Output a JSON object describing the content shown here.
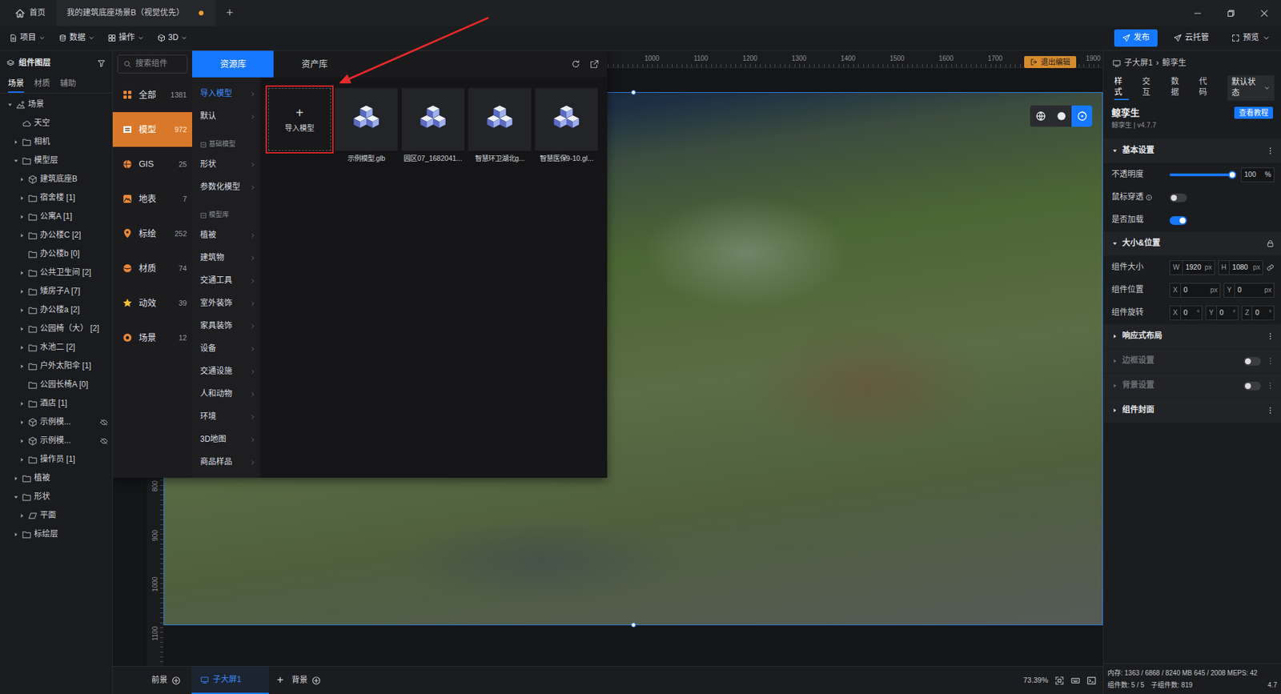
{
  "window": {
    "tabs": [
      {
        "label": "首页",
        "kind": "home",
        "selected": false,
        "unsaved": false
      },
      {
        "label": "我的建筑底座场景B（视觉优先）",
        "kind": "document",
        "selected": true,
        "unsaved": true
      }
    ],
    "add_tab": "+"
  },
  "toolbar": {
    "menus": [
      {
        "label": "项目",
        "kind": "file"
      },
      {
        "label": "数据",
        "kind": "database"
      },
      {
        "label": "操作",
        "kind": "grid"
      },
      {
        "label": "3D",
        "kind": "cube"
      }
    ],
    "actions": [
      {
        "label": "发布",
        "kind": "send",
        "primary": true,
        "dropdown": false
      },
      {
        "label": "云托管",
        "kind": "send",
        "primary": false,
        "dropdown": false
      },
      {
        "label": "预览",
        "kind": "fullscreen",
        "primary": false,
        "dropdown": true
      }
    ]
  },
  "layers": {
    "title": "组件图层",
    "tabs": [
      {
        "label": "场景",
        "selected": true
      },
      {
        "label": "材质",
        "selected": false
      },
      {
        "label": "辅助",
        "selected": false
      }
    ],
    "tree": [
      {
        "label": "场景",
        "level": 0,
        "kind": "scene",
        "expandable": true,
        "expanded": true,
        "hidden": false
      },
      {
        "label": "天空",
        "level": 1,
        "kind": "sky",
        "expandable": false,
        "expanded": false,
        "hidden": false
      },
      {
        "label": "相机",
        "level": 1,
        "kind": "folder",
        "expandable": true,
        "expanded": false,
        "hidden": false
      },
      {
        "label": "模型层",
        "level": 1,
        "kind": "folder",
        "expandable": true,
        "expanded": true,
        "hidden": false
      },
      {
        "label": "建筑底座B",
        "level": 2,
        "kind": "model",
        "expandable": true,
        "expanded": false,
        "hidden": false
      },
      {
        "label": "宿舍楼 [1]",
        "level": 2,
        "kind": "folder",
        "expandable": true,
        "expanded": false,
        "hidden": false
      },
      {
        "label": "公寓A [1]",
        "level": 2,
        "kind": "folder",
        "expandable": true,
        "expanded": false,
        "hidden": false
      },
      {
        "label": "办公楼C [2]",
        "level": 2,
        "kind": "folder",
        "expandable": true,
        "expanded": false,
        "hidden": false
      },
      {
        "label": "办公楼b [0]",
        "level": 2,
        "kind": "folder",
        "expandable": false,
        "expanded": false,
        "hidden": false
      },
      {
        "label": "公共卫生间 [2]",
        "level": 2,
        "kind": "folder",
        "expandable": true,
        "expanded": false,
        "hidden": false
      },
      {
        "label": "矮房子A [7]",
        "level": 2,
        "kind": "folder",
        "expandable": true,
        "expanded": false,
        "hidden": false
      },
      {
        "label": "办公楼a [2]",
        "level": 2,
        "kind": "folder",
        "expandable": true,
        "expanded": false,
        "hidden": false
      },
      {
        "label": "公园椅（大） [2]",
        "level": 2,
        "kind": "folder",
        "expandable": true,
        "expanded": false,
        "hidden": false
      },
      {
        "label": "水池二 [2]",
        "level": 2,
        "kind": "folder",
        "expandable": true,
        "expanded": false,
        "hidden": false
      },
      {
        "label": "户外太阳伞 [1]",
        "level": 2,
        "kind": "folder",
        "expandable": true,
        "expanded": false,
        "hidden": false
      },
      {
        "label": "公园长椅A [0]",
        "level": 2,
        "kind": "folder",
        "expandable": false,
        "expanded": false,
        "hidden": false
      },
      {
        "label": "酒店 [1]",
        "level": 2,
        "kind": "folder",
        "expandable": true,
        "expanded": false,
        "hidden": false
      },
      {
        "label": "示例模...",
        "level": 2,
        "kind": "model",
        "expandable": true,
        "expanded": false,
        "hidden": true
      },
      {
        "label": "示例模...",
        "level": 2,
        "kind": "model",
        "expandable": true,
        "expanded": false,
        "hidden": true
      },
      {
        "label": "操作员 [1]",
        "level": 2,
        "kind": "folder",
        "expandable": true,
        "expanded": false,
        "hidden": false
      },
      {
        "label": "植被",
        "level": 1,
        "kind": "folder",
        "expandable": true,
        "expanded": false,
        "hidden": false
      },
      {
        "label": "形状",
        "level": 1,
        "kind": "folder",
        "expandable": true,
        "expanded": true,
        "hidden": false
      },
      {
        "label": "平面",
        "level": 2,
        "kind": "plane",
        "expandable": true,
        "expanded": false,
        "hidden": false
      },
      {
        "label": "标绘层",
        "level": 1,
        "kind": "folder",
        "expandable": true,
        "expanded": false,
        "hidden": false
      }
    ]
  },
  "resources": {
    "search": {
      "placeholder": "搜索组件"
    },
    "categories": [
      {
        "label": "全部",
        "count": "1381",
        "kind": "all",
        "selected": false
      },
      {
        "label": "模型",
        "count": "972",
        "kind": "model",
        "selected": true
      },
      {
        "label": "GIS",
        "count": "25",
        "kind": "gis",
        "selected": false
      },
      {
        "label": "地表",
        "count": "7",
        "kind": "terrain",
        "selected": false
      },
      {
        "label": "标绘",
        "count": "252",
        "kind": "plot",
        "selected": false
      },
      {
        "label": "材质",
        "count": "74",
        "kind": "material",
        "selected": false
      },
      {
        "label": "动效",
        "count": "39",
        "kind": "effect",
        "selected": false
      },
      {
        "label": "场景",
        "count": "12",
        "kind": "scene",
        "selected": false
      }
    ],
    "tabs": [
      {
        "label": "资源库",
        "selected": true
      },
      {
        "label": "资产库",
        "selected": false
      }
    ],
    "subcategories": [
      {
        "label": "导入模型",
        "kind": "item",
        "selected": true
      },
      {
        "label": "默认",
        "kind": "item",
        "selected": false
      },
      {
        "label": "基础模型",
        "kind": "section",
        "selected": false
      },
      {
        "label": "形状",
        "kind": "item",
        "selected": false
      },
      {
        "label": "参数化模型",
        "kind": "item",
        "selected": false
      },
      {
        "label": "模型库",
        "kind": "section",
        "selected": false
      },
      {
        "label": "植被",
        "kind": "item",
        "selected": false
      },
      {
        "label": "建筑物",
        "kind": "item",
        "selected": false
      },
      {
        "label": "交通工具",
        "kind": "item",
        "selected": false
      },
      {
        "label": "室外装饰",
        "kind": "item",
        "selected": false
      },
      {
        "label": "家具装饰",
        "kind": "item",
        "selected": false
      },
      {
        "label": "设备",
        "kind": "item",
        "selected": false
      },
      {
        "label": "交通设施",
        "kind": "item",
        "selected": false
      },
      {
        "label": "人和动物",
        "kind": "item",
        "selected": false
      },
      {
        "label": "环境",
        "kind": "item",
        "selected": false
      },
      {
        "label": "3D地图",
        "kind": "item",
        "selected": false
      },
      {
        "label": "商品样品",
        "kind": "item",
        "selected": false
      }
    ],
    "items": [
      {
        "label": "导入模型",
        "symbol": "+",
        "kind": "import",
        "highlighted": true
      },
      {
        "label": "示例模型.glb",
        "kind": "model",
        "highlighted": false
      },
      {
        "label": "园区07_1682041...",
        "kind": "model",
        "highlighted": false
      },
      {
        "label": "智慧环卫湖北g...",
        "kind": "model",
        "highlighted": false
      },
      {
        "label": "智慧医保9-10.gl...",
        "kind": "model",
        "highlighted": false
      }
    ]
  },
  "canvas": {
    "ruler_top": [
      "1000",
      "1100",
      "1200",
      "1300",
      "1400",
      "1500",
      "1600",
      "1700",
      "1900"
    ],
    "ruler_left": [
      "800",
      "900",
      "1000",
      "1100"
    ],
    "exit_button": "退出编辑",
    "view_modes": [
      {
        "kind": "globe",
        "selected": false
      },
      {
        "kind": "sphere",
        "selected": false
      },
      {
        "kind": "orbit",
        "selected": true
      }
    ]
  },
  "bottom_bar": {
    "foreground": "前景",
    "screens": [
      {
        "label": "子大屏1",
        "selected": true
      }
    ],
    "add_screen": "+",
    "background": "背景",
    "zoom": "73.39%"
  },
  "properties": {
    "breadcrumb": {
      "items": [
        "子大屏1",
        "鲸孪生"
      ],
      "separator": "›"
    },
    "tabs": [
      {
        "label": "样式",
        "selected": true
      },
      {
        "label": "交互",
        "selected": false
      },
      {
        "label": "数据",
        "selected": false
      },
      {
        "label": "代码",
        "selected": false
      }
    ],
    "state_select": "默认状态",
    "component": {
      "name": "鲸孪生",
      "subtitle": "鲸孪生 | v4.7.7",
      "help_button": "查看教程"
    },
    "sections": [
      {
        "title": "基本设置",
        "expanded": true,
        "disabled": false,
        "locked": false,
        "has_toggle": false,
        "toggle_on": false,
        "has_menu": true,
        "rows": [
          {
            "kind": "slider",
            "label": "不透明度",
            "level": 1,
            "value": "100",
            "unit": "%"
          },
          {
            "kind": "toggle",
            "label": "鼠标穿透",
            "info": true,
            "on": false
          },
          {
            "kind": "toggle",
            "label": "是否加载",
            "info": false,
            "on": true
          }
        ]
      },
      {
        "title": "大小&位置",
        "expanded": true,
        "disabled": false,
        "locked": true,
        "has_toggle": false,
        "toggle_on": false,
        "has_menu": false,
        "rows": [
          {
            "kind": "fields",
            "label": "组件大小",
            "linked": true,
            "fields": [
              {
                "axis": "W",
                "value": "1920",
                "unit": "px"
              },
              {
                "axis": "H",
                "value": "1080",
                "unit": "px"
              }
            ]
          },
          {
            "kind": "fields",
            "label": "组件位置",
            "linked": false,
            "fields": [
              {
                "axis": "X",
                "value": "0",
                "unit": "px"
              },
              {
                "axis": "Y",
                "value": "0",
                "unit": "px"
              }
            ]
          },
          {
            "kind": "fields",
            "label": "组件旋转",
            "linked": false,
            "fields": [
              {
                "axis": "X",
                "value": "0",
                "unit": "°"
              },
              {
                "axis": "Y",
                "value": "0",
                "unit": "°"
              },
              {
                "axis": "Z",
                "value": "0",
                "unit": "°"
              }
            ]
          }
        ]
      },
      {
        "title": "响应式布局",
        "expanded": false,
        "disabled": false,
        "locked": false,
        "has_toggle": false,
        "toggle_on": false,
        "has_menu": true,
        "rows": []
      },
      {
        "title": "边框设置",
        "expanded": false,
        "disabled": true,
        "locked": false,
        "has_toggle": true,
        "toggle_on": false,
        "has_menu": true,
        "rows": []
      },
      {
        "title": "背景设置",
        "expanded": false,
        "disabled": true,
        "locked": false,
        "has_toggle": true,
        "toggle_on": false,
        "has_menu": true,
        "rows": []
      },
      {
        "title": "组件封面",
        "expanded": false,
        "disabled": false,
        "locked": false,
        "has_toggle": false,
        "toggle_on": false,
        "has_menu": true,
        "rows": []
      }
    ]
  },
  "status": {
    "memory": "内存: 1363 / 6868 / 8240 MB 645 / 2008 MEPS: 42",
    "components": "组件数: 5 / 5",
    "sub_components": "子组件数: 819",
    "version": "4.7"
  }
}
